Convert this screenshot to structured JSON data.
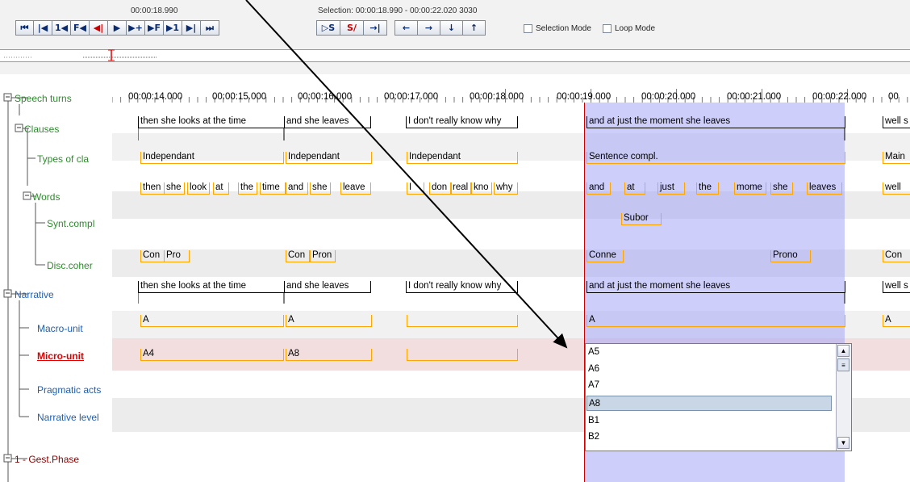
{
  "toolbar": {
    "current_time": "00:00:18.990",
    "selection_text": "Selection: 00:00:18.990 - 00:00:22.020  3030",
    "buttons_group1": [
      "⏮",
      "|◀",
      "1◀",
      "F◀",
      "◀|",
      "▶",
      "▶+",
      "▶F",
      "▶1",
      "▶|",
      "⏭"
    ],
    "buttons_group2": [
      "▷S",
      "S/",
      "→|"
    ],
    "buttons_group3": [
      "←",
      "→",
      "↓",
      "↑"
    ],
    "selection_mode_label": "Selection Mode",
    "loop_mode_label": "Loop Mode"
  },
  "ruler": {
    "ticks": [
      "00:00:14.000",
      "00:00:15.000",
      "00:00:16.000",
      "00:00:17.000",
      "00:00:18.000",
      "00:00:19.000",
      "00:00:20.000",
      "00:00:21.000",
      "00:00:22.000",
      "00"
    ]
  },
  "tiers": {
    "speech_turns": "Speech turns",
    "clauses": "Clauses",
    "types_of_cla": "Types of cla",
    "words": "Words",
    "synt_compl": "Synt.compl",
    "disc_coher": "Disc.coher",
    "narrative": "Narrative",
    "macro_unit": "Macro-unit",
    "micro_unit": "Micro-unit",
    "pragmatic_acts": "Pragmatic acts",
    "narrative_level": "Narrative level",
    "gest_phase": "1 - Gest.Phase"
  },
  "annotations": {
    "clauses": [
      "then she looks at the time",
      "and she leaves",
      "I don't really know why",
      "and at just the moment she leaves",
      "well s"
    ],
    "types": [
      "Independant",
      "Independant",
      "Independant",
      "Sentence compl.",
      "Main"
    ],
    "words": [
      "then",
      "she",
      "look",
      "at",
      "the",
      "time",
      "and",
      "she",
      "leave",
      "I",
      "don",
      "real",
      "kno",
      "why",
      "and",
      "at",
      "just",
      "the",
      "mome",
      "she",
      "leaves",
      "well"
    ],
    "synt": [
      "Subor"
    ],
    "disc": [
      "Con",
      "Pro",
      "Con",
      "Pron",
      "Conne",
      "Prono",
      "Con"
    ],
    "narrative": [
      "then she looks at the time",
      "and she leaves",
      "I don't really know why",
      "and at just the moment she leaves",
      "well s"
    ],
    "macro": [
      "A",
      "A",
      "A",
      "A"
    ],
    "micro": [
      "A4",
      "A8"
    ]
  },
  "dropdown": {
    "items": [
      "A5",
      "A6",
      "A7",
      "A8",
      "B1",
      "B2"
    ],
    "selected": "A8"
  },
  "colors": {
    "selection": "#a5a5f5",
    "crosshair": "#d00000",
    "tier_blue": "#1f5fb0",
    "tier_green": "#2e8b2e",
    "tier_red": "#8b0000",
    "active_tier": "#e00000",
    "annotation_line": "#ffa500"
  }
}
